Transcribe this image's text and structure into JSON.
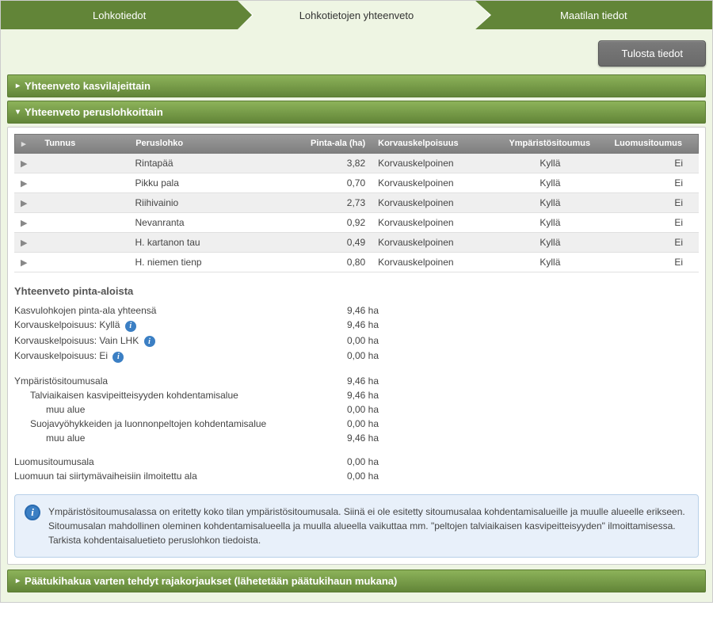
{
  "tabs": {
    "t0": "Lohkotiedot",
    "t1": "Lohkotietojen yhteenveto",
    "t2": "Maatilan tiedot"
  },
  "toolbar": {
    "print": "Tulosta tiedot"
  },
  "panels": {
    "p0": "Yhteenveto kasvilajeittain",
    "p1": "Yhteenveto peruslohkoittain",
    "p2": "Päätukihakua varten tehdyt rajakorjaukset (lähetetään päätukihaun mukana)"
  },
  "grid": {
    "headers": {
      "id": "Tunnus",
      "name": "Peruslohko",
      "area": "Pinta-ala (ha)",
      "korv": "Korvauskelpoisuus",
      "ymp": "Ympäristösitoumus",
      "luo": "Luomusitoumus"
    },
    "rows": [
      {
        "name": "Rintapää",
        "area": "3,82",
        "korv": "Korvauskelpoinen",
        "ymp": "Kyllä",
        "luo": "Ei"
      },
      {
        "name": "Pikku pala",
        "area": "0,70",
        "korv": "Korvauskelpoinen",
        "ymp": "Kyllä",
        "luo": "Ei"
      },
      {
        "name": "Riihivainio",
        "area": "2,73",
        "korv": "Korvauskelpoinen",
        "ymp": "Kyllä",
        "luo": "Ei"
      },
      {
        "name": "Nevanranta",
        "area": "0,92",
        "korv": "Korvauskelpoinen",
        "ymp": "Kyllä",
        "luo": "Ei"
      },
      {
        "name": "H. kartanon tau",
        "area": "0,49",
        "korv": "Korvauskelpoinen",
        "ymp": "Kyllä",
        "luo": "Ei"
      },
      {
        "name": "H. niemen tienp",
        "area": "0,80",
        "korv": "Korvauskelpoinen",
        "ymp": "Kyllä",
        "luo": "Ei"
      }
    ]
  },
  "summary": {
    "title": "Yhteenveto pinta-aloista",
    "rows": [
      {
        "label": "Kasvulohkojen pinta-ala yhteensä",
        "val": "9,46 ha"
      },
      {
        "label": "Korvauskelpoisuus: Kyllä",
        "val": "9,46 ha",
        "info": true
      },
      {
        "label": "Korvauskelpoisuus: Vain LHK",
        "val": "0,00 ha",
        "info": true
      },
      {
        "label": "Korvauskelpoisuus: Ei",
        "val": "0,00 ha",
        "info": true
      },
      {
        "gap": true
      },
      {
        "label": "Ympäristösitoumusala",
        "val": "9,46 ha"
      },
      {
        "label": "Talviaikaisen kasvipeitteisyyden kohdentamisalue",
        "val": "9,46 ha",
        "indent": 1
      },
      {
        "label": "muu alue",
        "val": "0,00 ha",
        "indent": 2
      },
      {
        "label": "Suojavyöhykkeiden ja luonnonpeltojen kohdentamisalue",
        "val": "0,00 ha",
        "indent": 1
      },
      {
        "label": "muu alue",
        "val": "9,46 ha",
        "indent": 2
      },
      {
        "gap": true
      },
      {
        "label": "Luomusitoumusala",
        "val": "0,00 ha"
      },
      {
        "label": "Luomuun tai siirtymävaiheisiin ilmoitettu ala",
        "val": "0,00 ha"
      }
    ]
  },
  "infobox": "Ympäristösitoumusalassa on eritetty koko tilan ympäristösitoumusala. Siinä ei ole esitetty sitoumusalaa kohdentamisalueille ja muulle alueelle erikseen. Sitoumusalan mahdollinen oleminen kohdentamisalueella ja muulla alueella vaikuttaa mm. \"peltojen talviaikaisen kasvipeitteisyyden\" ilmoittamisessa. Tarkista kohdentaisaluetieto peruslohkon tiedoista."
}
